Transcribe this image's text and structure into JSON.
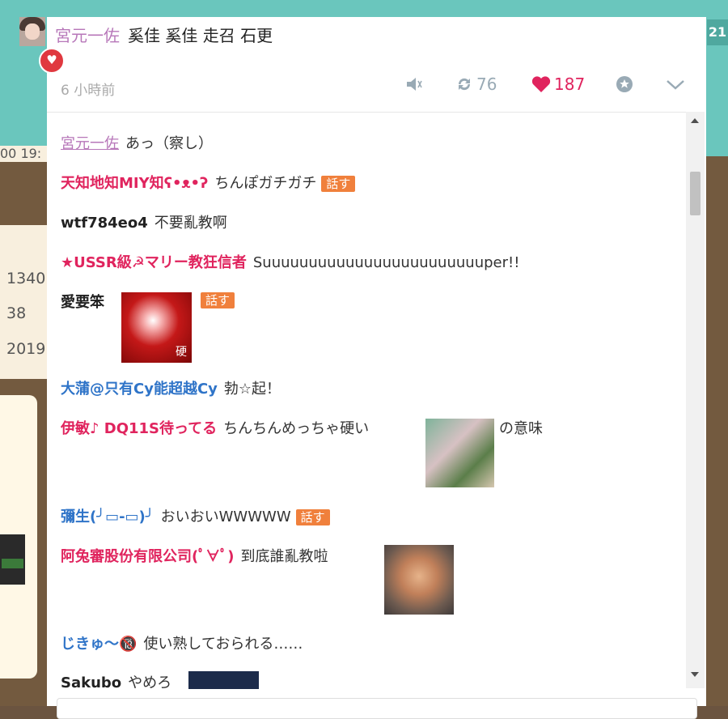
{
  "background": {
    "left_numbers": [
      "1340",
      "38",
      "2019"
    ],
    "left_time": "00 19:",
    "right_number": "21"
  },
  "post": {
    "author": "宮元一佐",
    "content": "奚佳 奚佳 走召 石更",
    "time": "6 小時前",
    "retweets": "76",
    "likes": "187"
  },
  "comments": [
    {
      "name": "宮元一佐",
      "text": "あっ（察し）"
    },
    {
      "name": "天知地知MIY知ʕ•ᴥ•ʔ",
      "text": "ちんぽガチガチ",
      "tag": "話す"
    },
    {
      "name": "wtf784eo4",
      "text": "不要亂教啊"
    },
    {
      "name": "★USSR級☭マリー教狂信者",
      "text": "Suuuuuuuuuuuuuuuuuuuuuuuuper!!"
    },
    {
      "name": "愛要笨",
      "image_label": "硬",
      "tag": "話す"
    },
    {
      "name": "大蒲@只有Cy能超越Cy",
      "text": "勃☆起！"
    },
    {
      "name": "伊敏♪ DQ11S待ってる",
      "text": "ちんちんめっちゃ硬い",
      "suffix": "の意味"
    },
    {
      "name": "彌生(╯▭-▭)╯",
      "text": "おいおいWWWWW",
      "tag": "話す"
    },
    {
      "name": "阿兔審股份有限公司(ﾟ∀ﾟ)",
      "text": "到底誰亂教啦"
    },
    {
      "name": "じきゅ〜🔞",
      "text": "使い熟しておられる……"
    },
    {
      "name": "Sakubo",
      "text": "やめろ"
    }
  ],
  "colors": {
    "accent_red": "#e0245e",
    "accent_purple": "#b777b9",
    "accent_blue": "#2f74c8",
    "tag_orange": "#f0803c"
  },
  "icons": [
    "mute-icon",
    "retweet-icon",
    "heart-icon",
    "star-icon",
    "chevron-down-icon"
  ]
}
